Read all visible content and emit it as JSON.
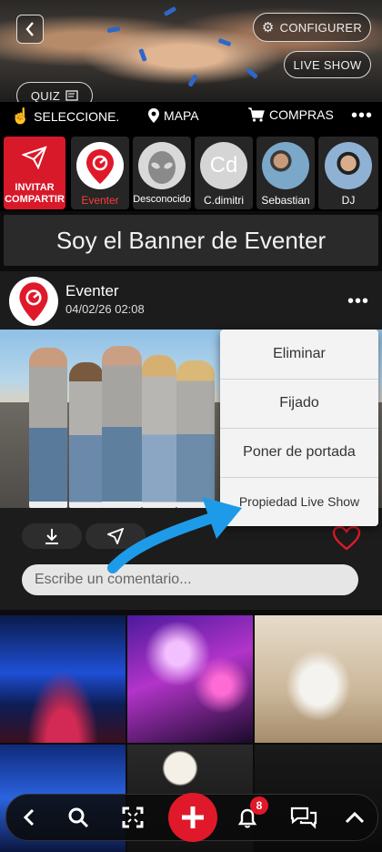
{
  "header": {
    "configurer_label": "CONFIGURER",
    "live_show_label": "LIVE SHOW",
    "quiz_label": "QUIZ"
  },
  "navbar": {
    "select_label": "SELECCIONE.",
    "map_label": "MAPA",
    "shop_label": "COMPRAS"
  },
  "stories": {
    "invite_line1": "INVITAR",
    "invite_line2": "COMPARTIR",
    "items": [
      {
        "label": "Eventer"
      },
      {
        "label": "Desconocido"
      },
      {
        "label": "C.dimitri",
        "initials": "Cd"
      },
      {
        "label": "Sebastian"
      },
      {
        "label": "DJ"
      }
    ]
  },
  "banner": {
    "text": "Soy el Banner de Eventer"
  },
  "post": {
    "author": "Eventer",
    "timestamp": "04/02/26 02:08",
    "comment_placeholder": "Escribe un comentario..."
  },
  "menu": {
    "items": [
      "Eliminar",
      "Fijado",
      "Poner de portada",
      "Propiedad Live Show"
    ]
  },
  "bottom_bar": {
    "notification_count": "8"
  },
  "colors": {
    "brand_red": "#e0192a",
    "accent_blue": "#1e9be8"
  }
}
